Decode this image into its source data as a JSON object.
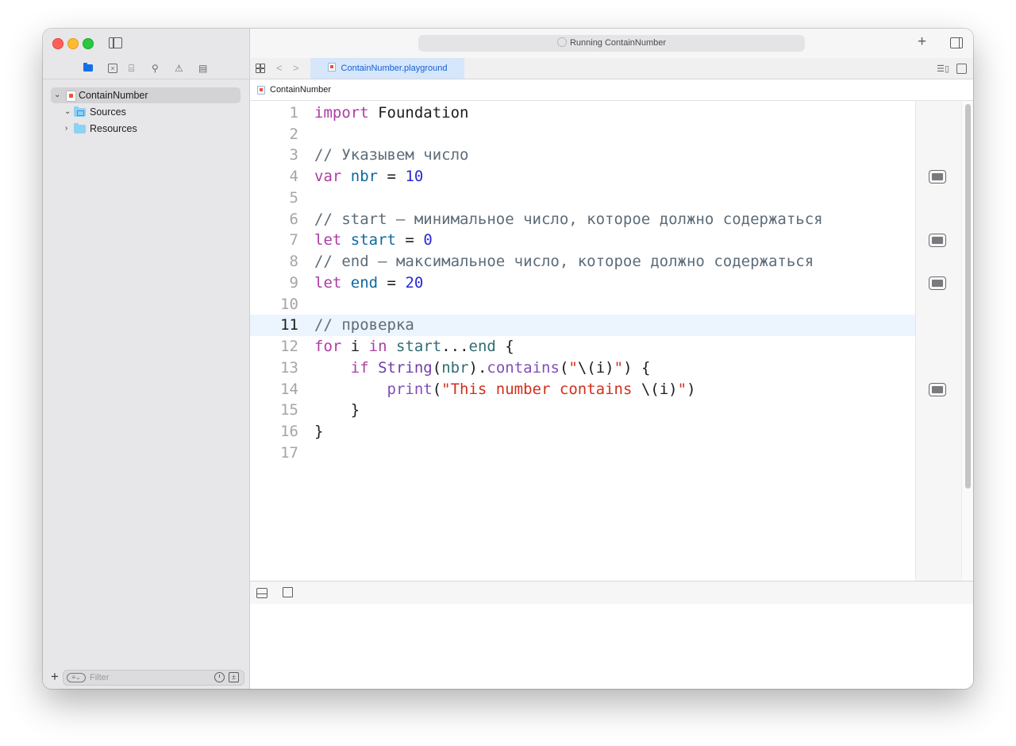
{
  "toolbar": {
    "activity_status": "Running ContainNumber"
  },
  "navigator": {
    "tree": [
      {
        "label": "ContainNumber",
        "type": "playground",
        "expanded": true,
        "selected": true
      },
      {
        "label": "Sources",
        "type": "folder",
        "expanded": true
      },
      {
        "label": "Resources",
        "type": "folder",
        "expanded": false
      }
    ],
    "filter_placeholder": "Filter"
  },
  "tab": {
    "label": "ContainNumber.playground"
  },
  "jumpbar": {
    "item": "ContainNumber"
  },
  "editor": {
    "current_line": 11,
    "line_numbers": [
      "1",
      "2",
      "3",
      "4",
      "5",
      "6",
      "7",
      "8",
      "9",
      "10",
      "11",
      "12",
      "13",
      "14",
      "15",
      "16",
      "17"
    ]
  },
  "colors": {
    "keyword": "#ad3da4",
    "comment": "#5d6c79",
    "number": "#272ad8",
    "string": "#d12f1b",
    "declaration": "#0f68a0",
    "type": "#703daa",
    "accent": "#1460d6"
  }
}
